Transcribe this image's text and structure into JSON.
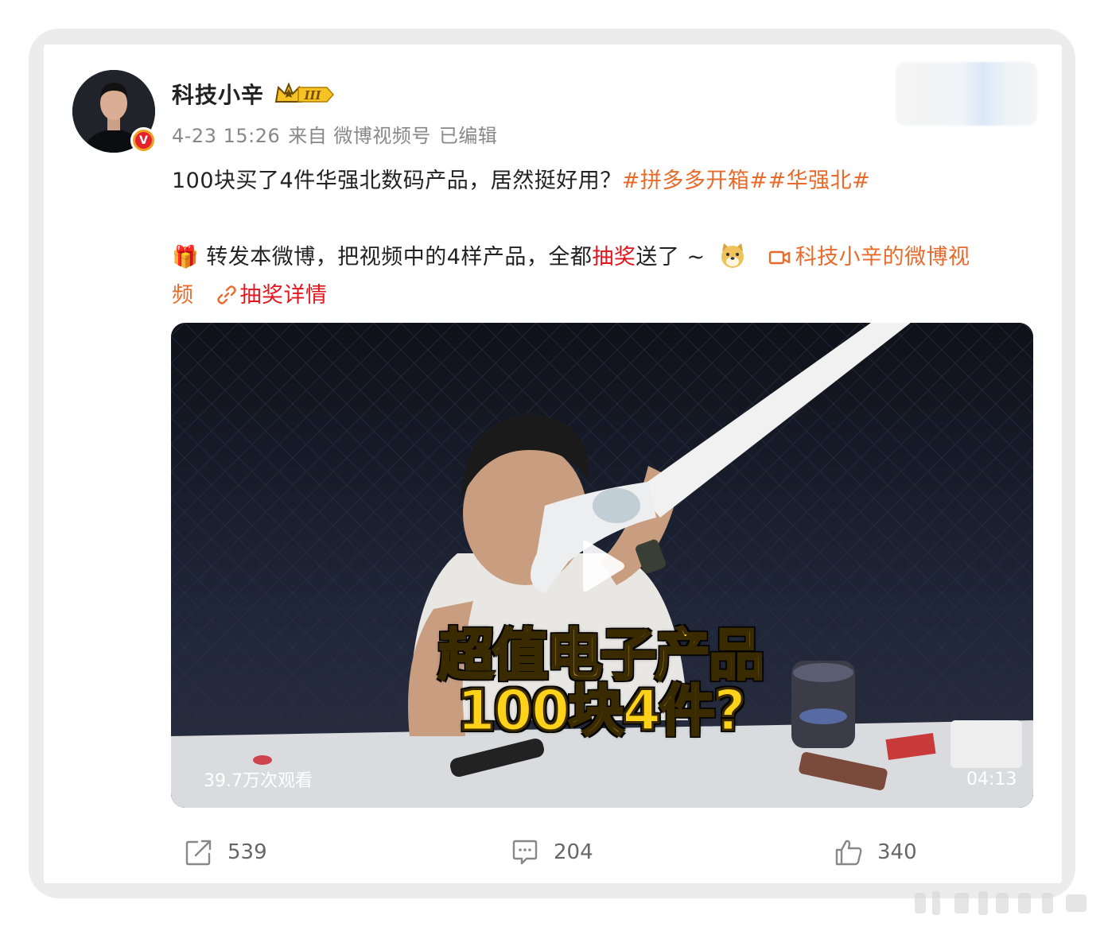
{
  "post": {
    "author": "科技小辛",
    "timestamp": "4-23 15:26",
    "source": "来自 微博视频号",
    "edited": "已编辑",
    "line1": {
      "text": "100块买了4件华强北数码产品，居然挺好用？",
      "hashtags": "#拼多多开箱##华强北#"
    },
    "line2": {
      "gift_emoji": "🎁",
      "text_a": " 转发本微博，把视频中的4样产品，全都",
      "lottery_word": "抽奖",
      "text_b": "送了 ~ ",
      "video_link_a": "科技小辛的微博视",
      "video_link_b": "频",
      "lottery_link": "抽奖详情"
    }
  },
  "video": {
    "caption_line1": "超值电子产品",
    "caption_line2": "100块4件?",
    "views": "39.7万次观看",
    "duration": "04:13"
  },
  "actions": {
    "repost_count": "539",
    "comment_count": "204",
    "like_count": "340"
  },
  "icons": {
    "verified": "verified-v-icon",
    "crown": "crown-level-3-icon",
    "repost": "repost-icon",
    "comment": "comment-icon",
    "like": "thumbs-up-icon",
    "play": "play-icon",
    "video_link": "video-camera-icon",
    "link": "link-icon"
  },
  "colors": {
    "hashtag": "#e86b2c",
    "lottery": "#e3141b",
    "username": "#222222",
    "meta": "#888888"
  }
}
